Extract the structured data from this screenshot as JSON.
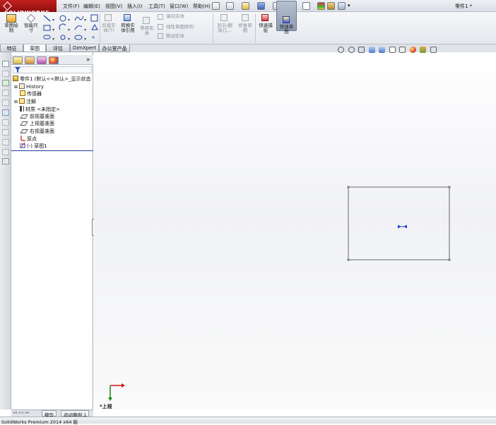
{
  "app": {
    "logo_text": "SOLIDWORKS",
    "document_title": "零件1 *"
  },
  "menu": [
    "文件(F)",
    "编辑(E)",
    "视图(V)",
    "插入(I)",
    "工具(T)",
    "窗口(W)",
    "帮助(H)"
  ],
  "toolbar": {
    "sketch_draw": "草图绘\n制",
    "smart_dimension": "智能尺\n寸",
    "trim_entities": "剪裁实\n体(T)",
    "convert_entities": "转换实\n体引用",
    "offset_entities": "等距实\n体",
    "mirror_entities": "镜向实体",
    "linear_pattern": "线性草图阵列",
    "move_entities": "移动实体",
    "show_delete_relations": "显示/删\n除几...",
    "repair_sketch": "修复草\n图",
    "quick_snap": "快速捕\n捉",
    "quick_sketch": "快速草\n图"
  },
  "tabs": [
    "特征",
    "草图",
    "评估",
    "DimXpert",
    "办公室产品"
  ],
  "active_tab": "草图",
  "tree": {
    "root": "零件1 (默认<<默认>_显示状态",
    "items": [
      "History",
      "传感器",
      "注解",
      "材质 <未指定>",
      "前视基准面",
      "上视基准面",
      "右视基准面",
      "原点",
      "(-) 草图1"
    ]
  },
  "panel_expand_glyph": "»",
  "view_label": "*上视",
  "bottom_tabs": [
    "模型",
    "运动算例 1"
  ],
  "status_text": "SolidWorks Premium 2014 x64 版",
  "colors": {
    "logo_red": "#b31616",
    "sketch_line": "#7f7f7f",
    "axis_x": "#d01818",
    "axis_y": "#1a8a1a",
    "origin_blue": "#1f3fd0"
  }
}
